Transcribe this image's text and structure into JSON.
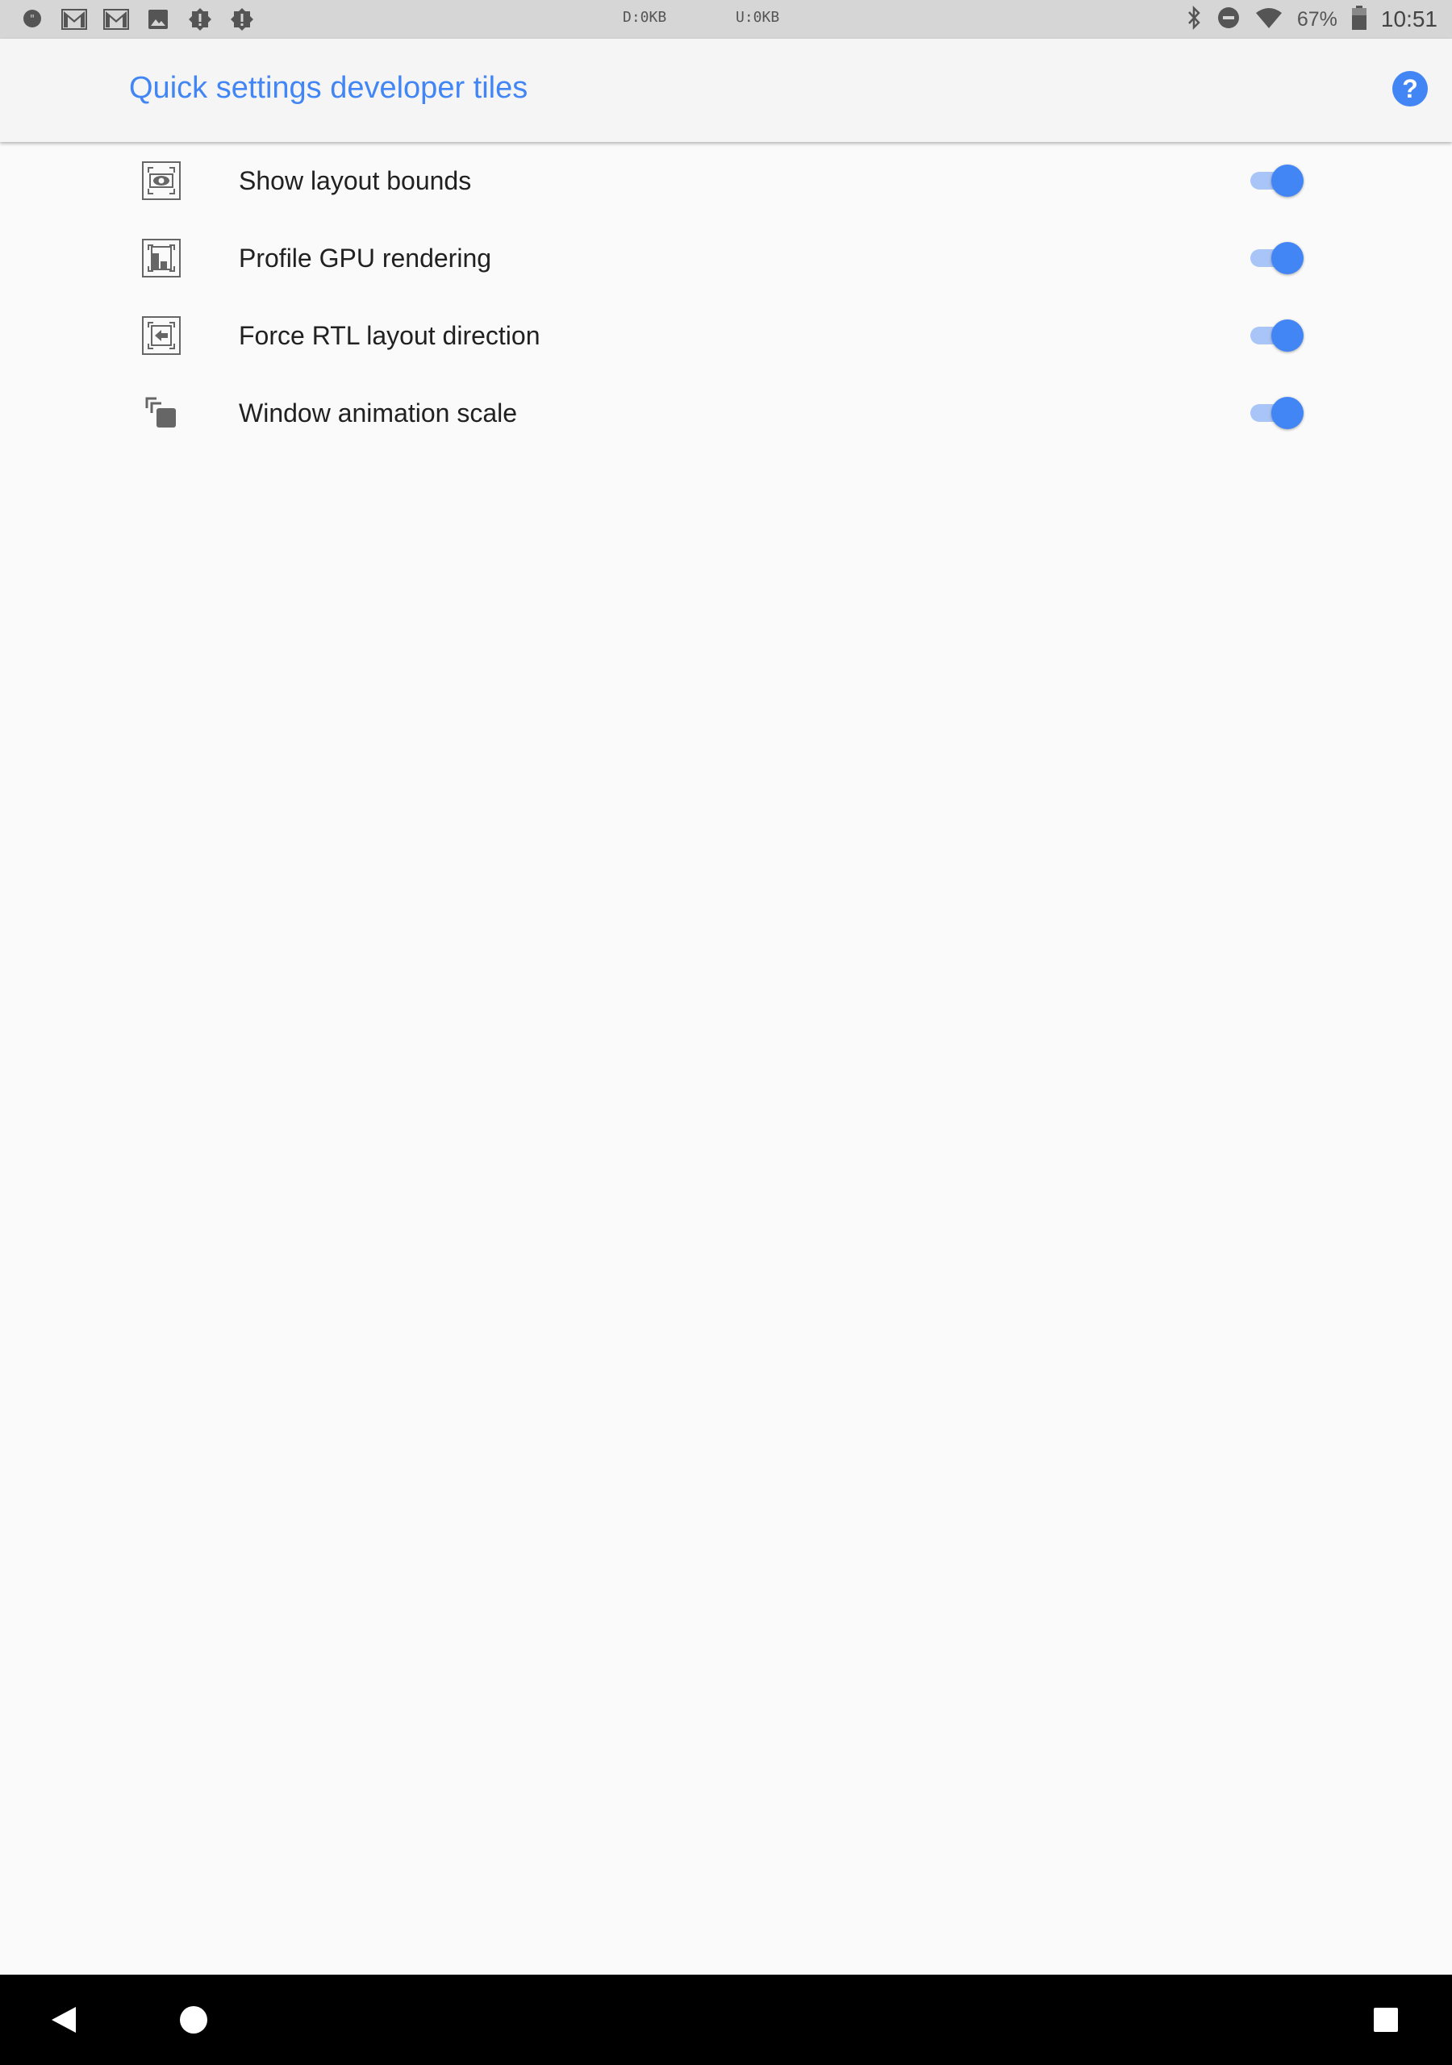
{
  "status_bar": {
    "notification_icons": [
      "hangouts-icon",
      "gmail-icon",
      "gmail-icon",
      "photo-icon",
      "alert-icon",
      "alert-icon"
    ],
    "download_speed": "D:0KB",
    "upload_speed": "U:0KB",
    "battery_percent": "67%",
    "time": "10:51"
  },
  "app_bar": {
    "title": "Quick settings developer tiles",
    "help_label": "?"
  },
  "tiles": [
    {
      "label": "Show layout bounds",
      "icon": "layout-bounds-icon",
      "enabled": true
    },
    {
      "label": "Profile GPU rendering",
      "icon": "gpu-rendering-icon",
      "enabled": true
    },
    {
      "label": "Force RTL layout direction",
      "icon": "rtl-direction-icon",
      "enabled": true
    },
    {
      "label": "Window animation scale",
      "icon": "animation-scale-icon",
      "enabled": true
    }
  ],
  "colors": {
    "accent": "#4285f4",
    "switch_track": "#a9c5f7",
    "nav_bar": "#000000",
    "status_bar": "#d6d6d6"
  }
}
